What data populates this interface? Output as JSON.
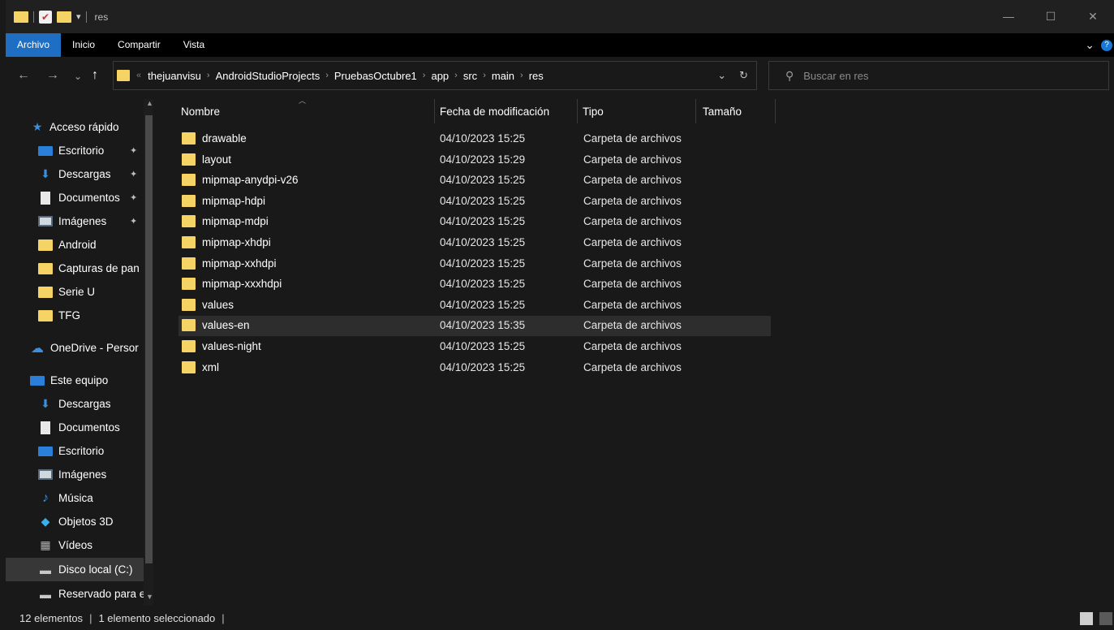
{
  "window": {
    "title": "res",
    "controls": {
      "minimize": "—",
      "maximize": "☐",
      "close": "✕"
    }
  },
  "ribbon": {
    "tabs": [
      "Archivo",
      "Inicio",
      "Compartir",
      "Vista"
    ],
    "active_tab": "Archivo",
    "expand_glyph": "⌄",
    "help_glyph": "?"
  },
  "nav": {
    "back": "←",
    "forward": "→",
    "recent": "⌄",
    "up": "↑"
  },
  "address": {
    "overflow": "«",
    "crumbs": [
      "thejuanvisu",
      "AndroidStudioProjects",
      "PruebasOctubre1",
      "app",
      "src",
      "main",
      "res"
    ],
    "sep": "›",
    "dropdown": "⌄",
    "refresh": "↻"
  },
  "search": {
    "placeholder": "Buscar en res",
    "value": ""
  },
  "sidebar": {
    "items": [
      {
        "label": "Acceso rápido",
        "icon": "star-icon",
        "pinned": false
      },
      {
        "label": "Escritorio",
        "icon": "desktop-icon",
        "pinned": true
      },
      {
        "label": "Descargas",
        "icon": "download-icon",
        "pinned": true
      },
      {
        "label": "Documentos",
        "icon": "document-icon",
        "pinned": true
      },
      {
        "label": "Imágenes",
        "icon": "pictures-icon",
        "pinned": true
      },
      {
        "label": "Android",
        "icon": "folder-icon",
        "pinned": false
      },
      {
        "label": "Capturas de pan",
        "icon": "folder-icon",
        "pinned": false
      },
      {
        "label": "Serie U",
        "icon": "folder-icon",
        "pinned": false
      },
      {
        "label": "TFG",
        "icon": "folder-icon",
        "pinned": false
      },
      {
        "label": "OneDrive - Persor",
        "icon": "cloud-icon",
        "pinned": false
      },
      {
        "label": "Este equipo",
        "icon": "computer-icon",
        "pinned": false
      },
      {
        "label": "Descargas",
        "icon": "download-icon",
        "pinned": false
      },
      {
        "label": "Documentos",
        "icon": "document-icon",
        "pinned": false
      },
      {
        "label": "Escritorio",
        "icon": "desktop-icon",
        "pinned": false
      },
      {
        "label": "Imágenes",
        "icon": "pictures-icon",
        "pinned": false
      },
      {
        "label": "Música",
        "icon": "music-icon",
        "pinned": false
      },
      {
        "label": "Objetos 3D",
        "icon": "cube-icon",
        "pinned": false
      },
      {
        "label": "Vídeos",
        "icon": "video-icon",
        "pinned": false
      },
      {
        "label": "Disco local (C:)",
        "icon": "drive-icon",
        "pinned": false
      },
      {
        "label": "Reservado para e",
        "icon": "drive-icon",
        "pinned": false
      }
    ],
    "selected_index": 18
  },
  "columns": [
    "Nombre",
    "Fecha de modificación",
    "Tipo",
    "Tamaño"
  ],
  "files": [
    {
      "name": "drawable",
      "date": "04/10/2023 15:25",
      "type": "Carpeta de archivos",
      "size": ""
    },
    {
      "name": "layout",
      "date": "04/10/2023 15:29",
      "type": "Carpeta de archivos",
      "size": ""
    },
    {
      "name": "mipmap-anydpi-v26",
      "date": "04/10/2023 15:25",
      "type": "Carpeta de archivos",
      "size": ""
    },
    {
      "name": "mipmap-hdpi",
      "date": "04/10/2023 15:25",
      "type": "Carpeta de archivos",
      "size": ""
    },
    {
      "name": "mipmap-mdpi",
      "date": "04/10/2023 15:25",
      "type": "Carpeta de archivos",
      "size": ""
    },
    {
      "name": "mipmap-xhdpi",
      "date": "04/10/2023 15:25",
      "type": "Carpeta de archivos",
      "size": ""
    },
    {
      "name": "mipmap-xxhdpi",
      "date": "04/10/2023 15:25",
      "type": "Carpeta de archivos",
      "size": ""
    },
    {
      "name": "mipmap-xxxhdpi",
      "date": "04/10/2023 15:25",
      "type": "Carpeta de archivos",
      "size": ""
    },
    {
      "name": "values",
      "date": "04/10/2023 15:25",
      "type": "Carpeta de archivos",
      "size": ""
    },
    {
      "name": "values-en",
      "date": "04/10/2023 15:35",
      "type": "Carpeta de archivos",
      "size": ""
    },
    {
      "name": "values-night",
      "date": "04/10/2023 15:25",
      "type": "Carpeta de archivos",
      "size": ""
    },
    {
      "name": "xml",
      "date": "04/10/2023 15:25",
      "type": "Carpeta de archivos",
      "size": ""
    }
  ],
  "selected_file_index": 9,
  "status": {
    "count": "12 elementos",
    "selection": "1 elemento seleccionado",
    "sep": "|"
  },
  "colors": {
    "accent": "#1e6fc4",
    "folder": "#f6d365",
    "background": "#191919"
  }
}
